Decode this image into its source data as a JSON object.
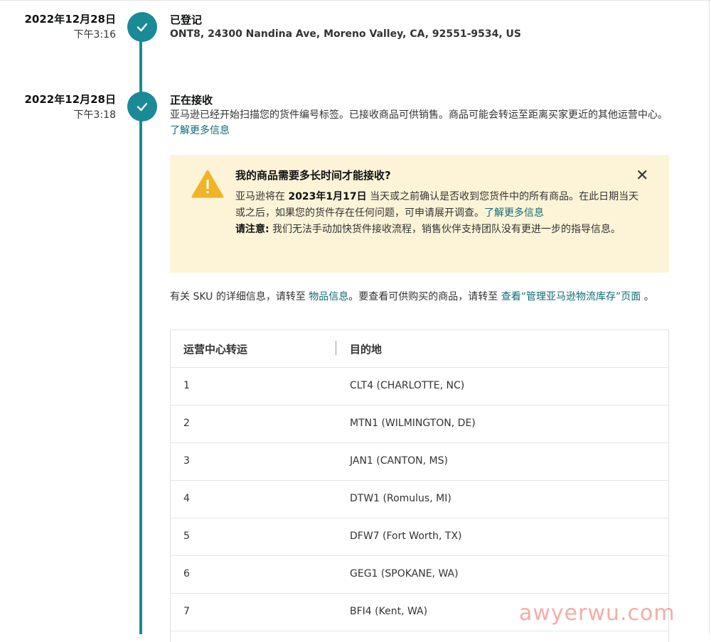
{
  "events": [
    {
      "date": "2022年12月28日",
      "time": "下午3:16",
      "title": "已登记",
      "address": "ONT8, 24300 Nandina Ave, Moreno Valley, CA, 92551-9534, US"
    },
    {
      "date": "2022年12月28日",
      "time": "下午3:18",
      "title": "正在接收",
      "desc": "亚马逊已经开始扫描您的货件编号标签。已接收商品可供销售。商品可能会转运至距离买家更近的其他运营中心。",
      "link": "了解更多信息"
    }
  ],
  "alert": {
    "title": "我的商品需要多长时间才能接收?",
    "close": "✕",
    "line1_pre": "亚马逊将在 ",
    "line1_date": "2023年1月17日",
    "line1_post": " 当天或之前确认是否收到您货件中的所有商品。在此日期当天或之后，如果您的货件存在任何问题，可申请展开调查。",
    "link": "了解更多信息",
    "note_label": "请注意:",
    "note_text": " 我们无法手动加快货件接收流程，销售伙伴支持团队没有更进一步的指导信息。"
  },
  "sku": {
    "pre": "有关 SKU 的详细信息，请转至 ",
    "link1": "物品信息",
    "mid": "。要查看可供购买的商品，请转至 ",
    "link2": "查看“管理亚马逊物流库存”页面",
    "post": " 。"
  },
  "table": {
    "headers": [
      "运营中心转运",
      "目的地"
    ],
    "rows": [
      [
        "1",
        "CLT4 (CHARLOTTE, NC)"
      ],
      [
        "2",
        "MTN1 (WILMINGTON, DE)"
      ],
      [
        "3",
        "JAN1 (CANTON, MS)"
      ],
      [
        "4",
        "DTW1 (Romulus, MI)"
      ],
      [
        "5",
        "DFW7 (Fort Worth, TX)"
      ],
      [
        "6",
        "GEG1 (SPOKANE, WA)"
      ],
      [
        "7",
        "BFI4 (Kent, WA)"
      ]
    ]
  },
  "watermark": "awyerwu.com",
  "colors": {
    "accent": "#1a8a96",
    "alert_bg": "#fdf4d8",
    "warning": "#f0b429",
    "link": "#0e6b77"
  }
}
